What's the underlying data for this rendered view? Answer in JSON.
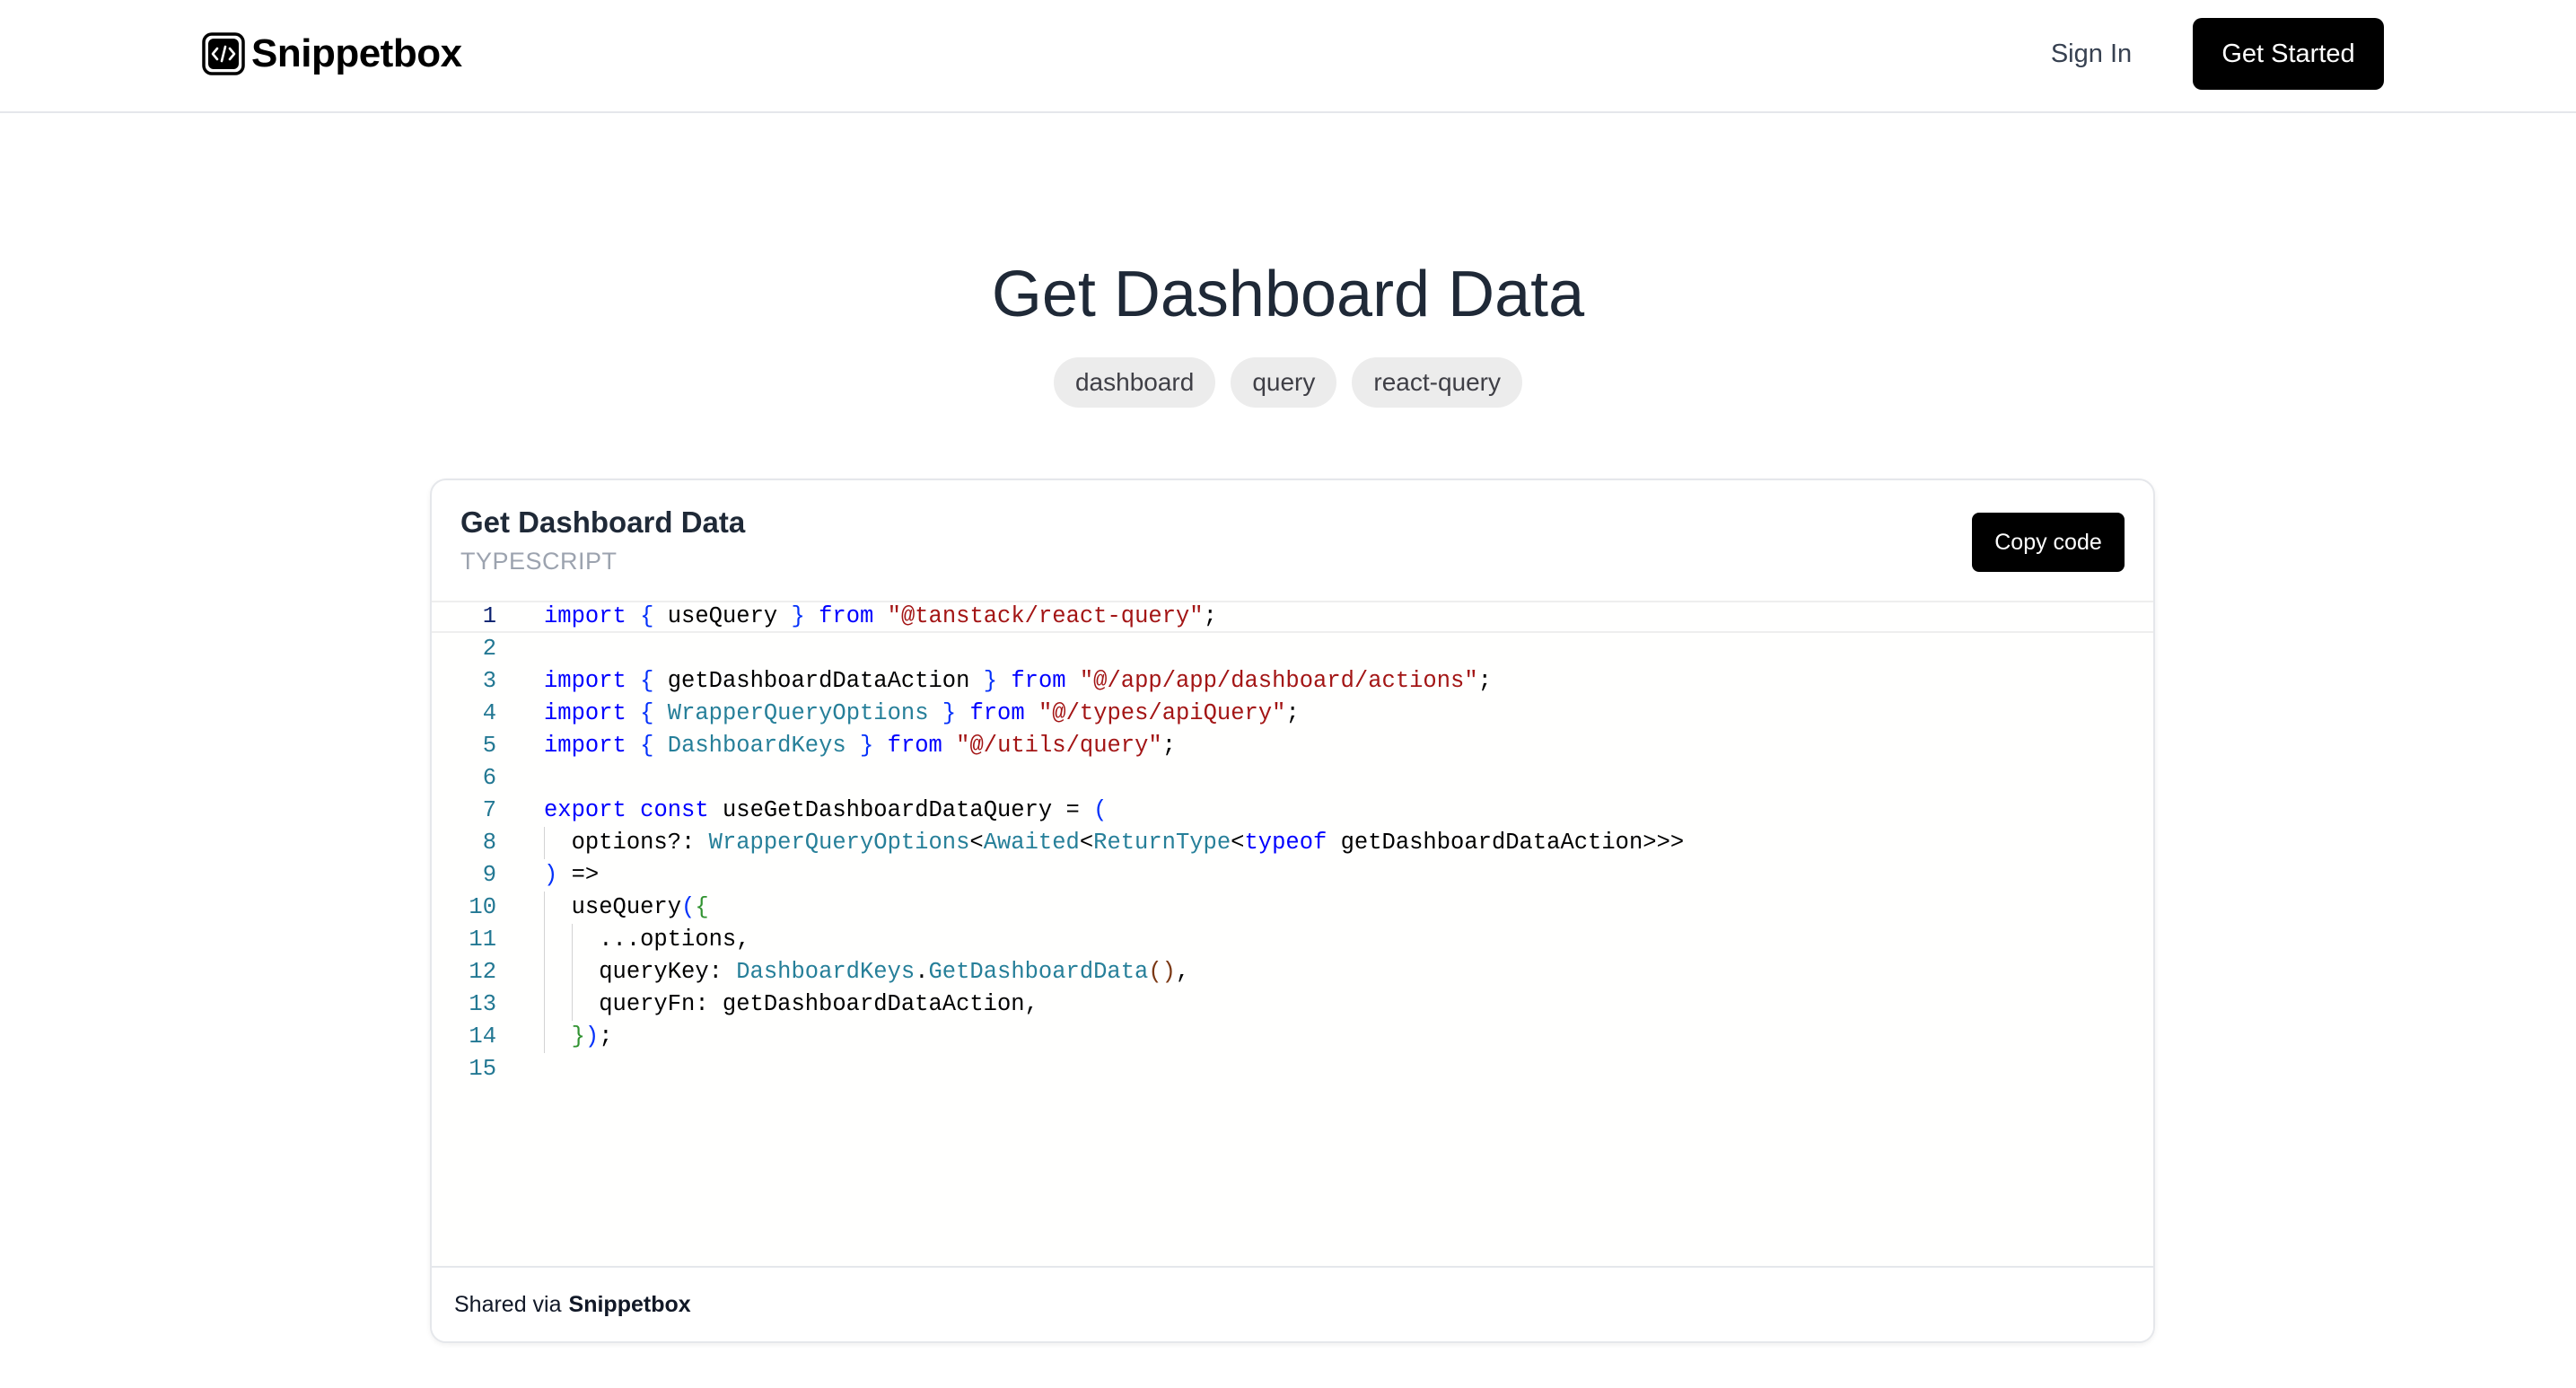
{
  "header": {
    "brand": "Snippetbox",
    "signin_label": "Sign In",
    "getstarted_label": "Get Started"
  },
  "page": {
    "title": "Get Dashboard Data",
    "tags": [
      "dashboard",
      "query",
      "react-query"
    ]
  },
  "snippet": {
    "title": "Get Dashboard Data",
    "language": "TYPESCRIPT",
    "copy_label": "Copy code",
    "active_line": 1,
    "line_numbers": [
      "1",
      "2",
      "3",
      "4",
      "5",
      "6",
      "7",
      "8",
      "9",
      "10",
      "11",
      "12",
      "13",
      "14",
      "15"
    ],
    "code_lines": [
      "import { useQuery } from \"@tanstack/react-query\";",
      "",
      "import { getDashboardDataAction } from \"@/app/app/dashboard/actions\";",
      "import { WrapperQueryOptions } from \"@/types/apiQuery\";",
      "import { DashboardKeys } from \"@/utils/query\";",
      "",
      "export const useGetDashboardDataQuery = (",
      "  options?: WrapperQueryOptions<Awaited<ReturnType<typeof getDashboardDataAction>>>",
      ") =>",
      "  useQuery({",
      "    ...options,",
      "    queryKey: DashboardKeys.GetDashboardData(),",
      "    queryFn: getDashboardDataAction,",
      "  });",
      ""
    ]
  },
  "footer": {
    "shared_prefix": "Shared via",
    "shared_brand": "Snippetbox"
  },
  "icons": {
    "logo": "code-square-icon"
  },
  "colors": {
    "primary_button": "#000000",
    "keyword": "#0000ff",
    "string": "#a31515",
    "type": "#267f99",
    "line_number": "#237893",
    "tag_bg": "#ececec"
  }
}
